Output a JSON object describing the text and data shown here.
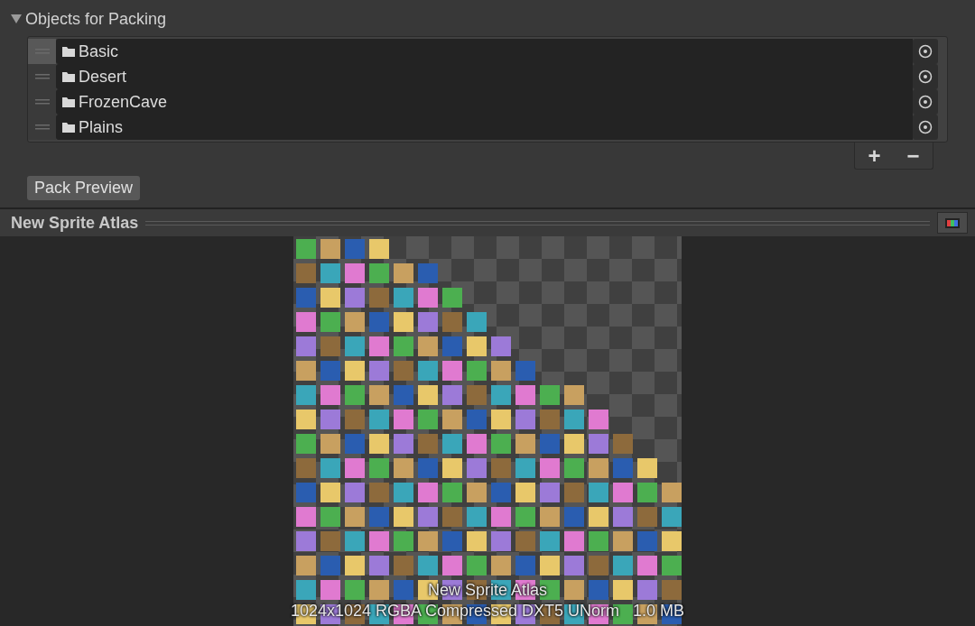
{
  "packing_section": {
    "title": "Objects for Packing",
    "expanded": true,
    "items": [
      {
        "label": "Basic",
        "selected": true
      },
      {
        "label": "Desert",
        "selected": false
      },
      {
        "label": "FrozenCave",
        "selected": false
      },
      {
        "label": "Plains",
        "selected": false
      }
    ],
    "add_button": "+",
    "remove_button": "−"
  },
  "pack_preview_button": "Pack Preview",
  "preview": {
    "title": "New Sprite Atlas",
    "caption_name": "New Sprite Atlas",
    "caption_info": "1024x1024 RGBA Compressed DXT5 UNorm   1.0 MB"
  }
}
